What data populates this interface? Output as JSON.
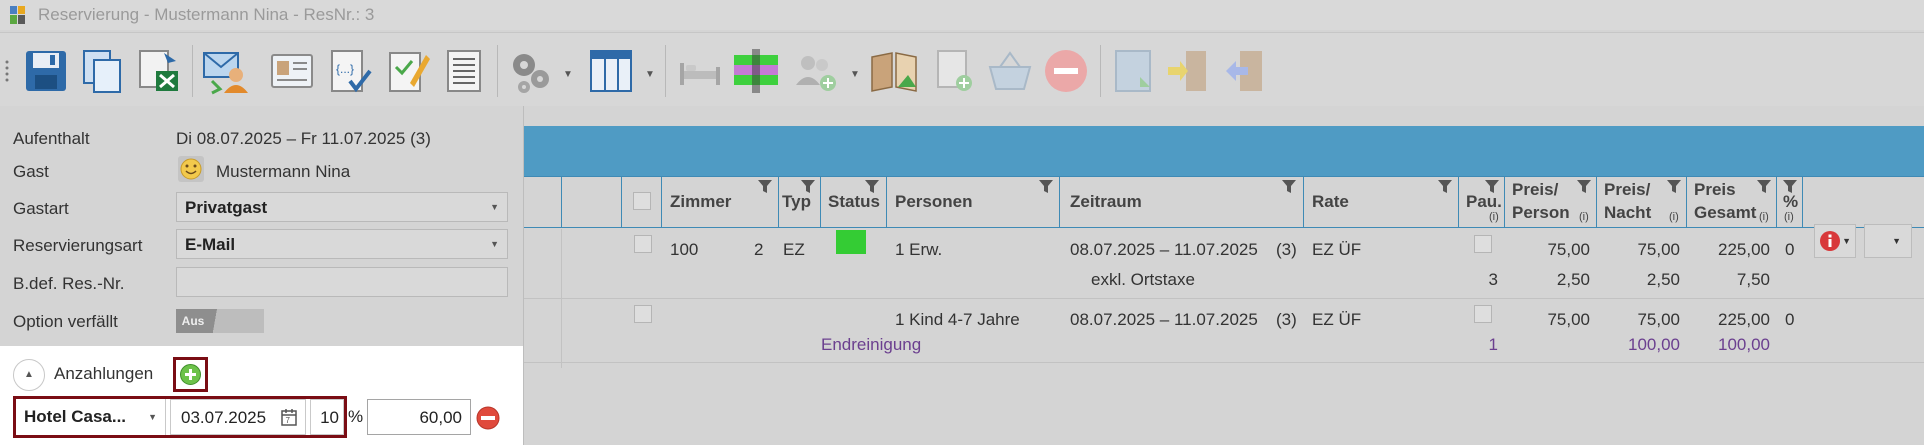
{
  "window": {
    "title": "Reservierung - Mustermann Nina - ResNr.: 3"
  },
  "toolbar": {
    "buttons": [
      {
        "icon": "save-icon"
      },
      {
        "icon": "copy-icon"
      },
      {
        "icon": "excel-export-icon"
      },
      {
        "icon": "mail-guest-icon"
      },
      {
        "icon": "registration-card-icon"
      },
      {
        "icon": "confirmation-document-icon"
      },
      {
        "icon": "edit-document-icon"
      },
      {
        "icon": "list-document-icon"
      },
      {
        "icon": "settings-gears-icon"
      },
      {
        "icon": "column-layout-icon"
      },
      {
        "icon": "bed-icon"
      },
      {
        "icon": "room-move-icon"
      },
      {
        "icon": "add-guests-icon"
      },
      {
        "icon": "guest-book-icon"
      },
      {
        "icon": "add-document-icon"
      },
      {
        "icon": "basket-icon"
      },
      {
        "icon": "cancel-icon"
      },
      {
        "icon": "invoice-icon"
      },
      {
        "icon": "checkin-door-icon"
      },
      {
        "icon": "checkout-door-icon"
      }
    ]
  },
  "form": {
    "aufenthalt": {
      "label": "Aufenthalt",
      "value": "Di 08.07.2025 – Fr 11.07.2025 (3)"
    },
    "gast": {
      "label": "Gast",
      "value": "Mustermann Nina"
    },
    "gastart": {
      "label": "Gastart",
      "value": "Privatgast"
    },
    "reservierungsart": {
      "label": "Reservierungsart",
      "value": "E-Mail"
    },
    "bdef": {
      "label": "B.def. Res.-Nr.",
      "value": ""
    },
    "option": {
      "label": "Option verfällt",
      "toggle": "Aus"
    }
  },
  "anzahlungen": {
    "label": "Anzahlungen",
    "hotel": "Hotel Casa...",
    "date": "03.07.2025",
    "percent": "10",
    "percent_sign": "%",
    "amount": "60,00"
  },
  "grid": {
    "columns": {
      "zimmer": "Zimmer",
      "typ": "Typ",
      "status": "Status",
      "personen": "Personen",
      "zeitraum": "Zeitraum",
      "rate": "Rate",
      "pau": "Pau.",
      "pau_sub": "(i)",
      "preis_person_1": "Preis/",
      "preis_person_2": "Person",
      "preis_person_sub": "(i)",
      "preis_nacht_1": "Preis/",
      "preis_nacht_2": "Nacht",
      "preis_nacht_sub": "(i)",
      "preis_gesamt_1": "Preis",
      "preis_gesamt_2": "Gesamt",
      "preis_gesamt_sub": "(i)",
      "pct": "%",
      "pct_sub": "(i)"
    },
    "rows": [
      {
        "zimmer": "100",
        "count": "2",
        "typ": "EZ",
        "status_color": "#34cc34",
        "personen": "1 Erw.",
        "zeitraum": "08.07.2025 – 11.07.2025",
        "nights": "(3)",
        "rate": "EZ ÜF",
        "preis_person": "75,00",
        "preis_nacht": "75,00",
        "preis_gesamt": "225,00",
        "pct": "0"
      },
      {
        "sub_label": "exkl. Ortstaxe",
        "pau": "3",
        "preis_person": "2,50",
        "preis_nacht": "2,50",
        "preis_gesamt": "7,50"
      },
      {
        "personen": "1 Kind 4-7 Jahre",
        "zeitraum": "08.07.2025 – 11.07.2025",
        "nights": "(3)",
        "rate": "EZ ÜF",
        "preis_person": "75,00",
        "preis_nacht": "75,00",
        "preis_gesamt": "225,00",
        "pct": "0"
      },
      {
        "extra_label": "Endreinigung",
        "pau": "1",
        "preis_nacht": "100,00",
        "preis_gesamt": "100,00"
      }
    ]
  },
  "colors": {
    "header_blue": "#4f9bc4",
    "accent_dark_red": "#7a0d14",
    "status_green": "#34cc34",
    "extra_purple": "#6b3f8f"
  }
}
